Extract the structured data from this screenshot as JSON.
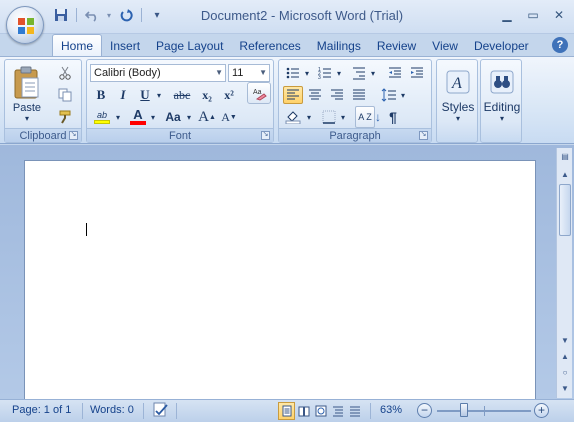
{
  "window": {
    "title": "Document2 - Microsoft Word (Trial)"
  },
  "quick_access": {
    "save_icon": "save-icon",
    "undo_icon": "undo-icon",
    "redo_icon": "redo-icon",
    "customize_icon": "customize-icon"
  },
  "tabs": [
    {
      "label": "Home",
      "active": true
    },
    {
      "label": "Insert"
    },
    {
      "label": "Page Layout"
    },
    {
      "label": "References"
    },
    {
      "label": "Mailings"
    },
    {
      "label": "Review"
    },
    {
      "label": "View"
    },
    {
      "label": "Developer"
    }
  ],
  "help": {
    "label": "?"
  },
  "clipboard": {
    "paste_label": "Paste",
    "group_label": "Clipboard"
  },
  "font": {
    "font_name": "Calibri (Body)",
    "font_size": "11",
    "bold": "B",
    "italic": "I",
    "underline": "U",
    "strike": "abc",
    "subscript": "x₂",
    "superscript": "x²",
    "grow": "A",
    "shrink": "A",
    "change_case": "Aa",
    "highlight": "ab",
    "font_color": "A",
    "group_label": "Font"
  },
  "paragraph": {
    "group_label": "Paragraph",
    "sort": "A Z",
    "pilcrow": "¶"
  },
  "styles": {
    "label": "Styles"
  },
  "editing": {
    "label": "Editing"
  },
  "statusbar": {
    "page": "Page: 1 of 1",
    "words": "Words: 0",
    "zoom": "63%",
    "zoom_level": 63
  },
  "colors": {
    "accent": "#15428b",
    "highlight": "#ffff00",
    "font_color": "#ff0000"
  }
}
